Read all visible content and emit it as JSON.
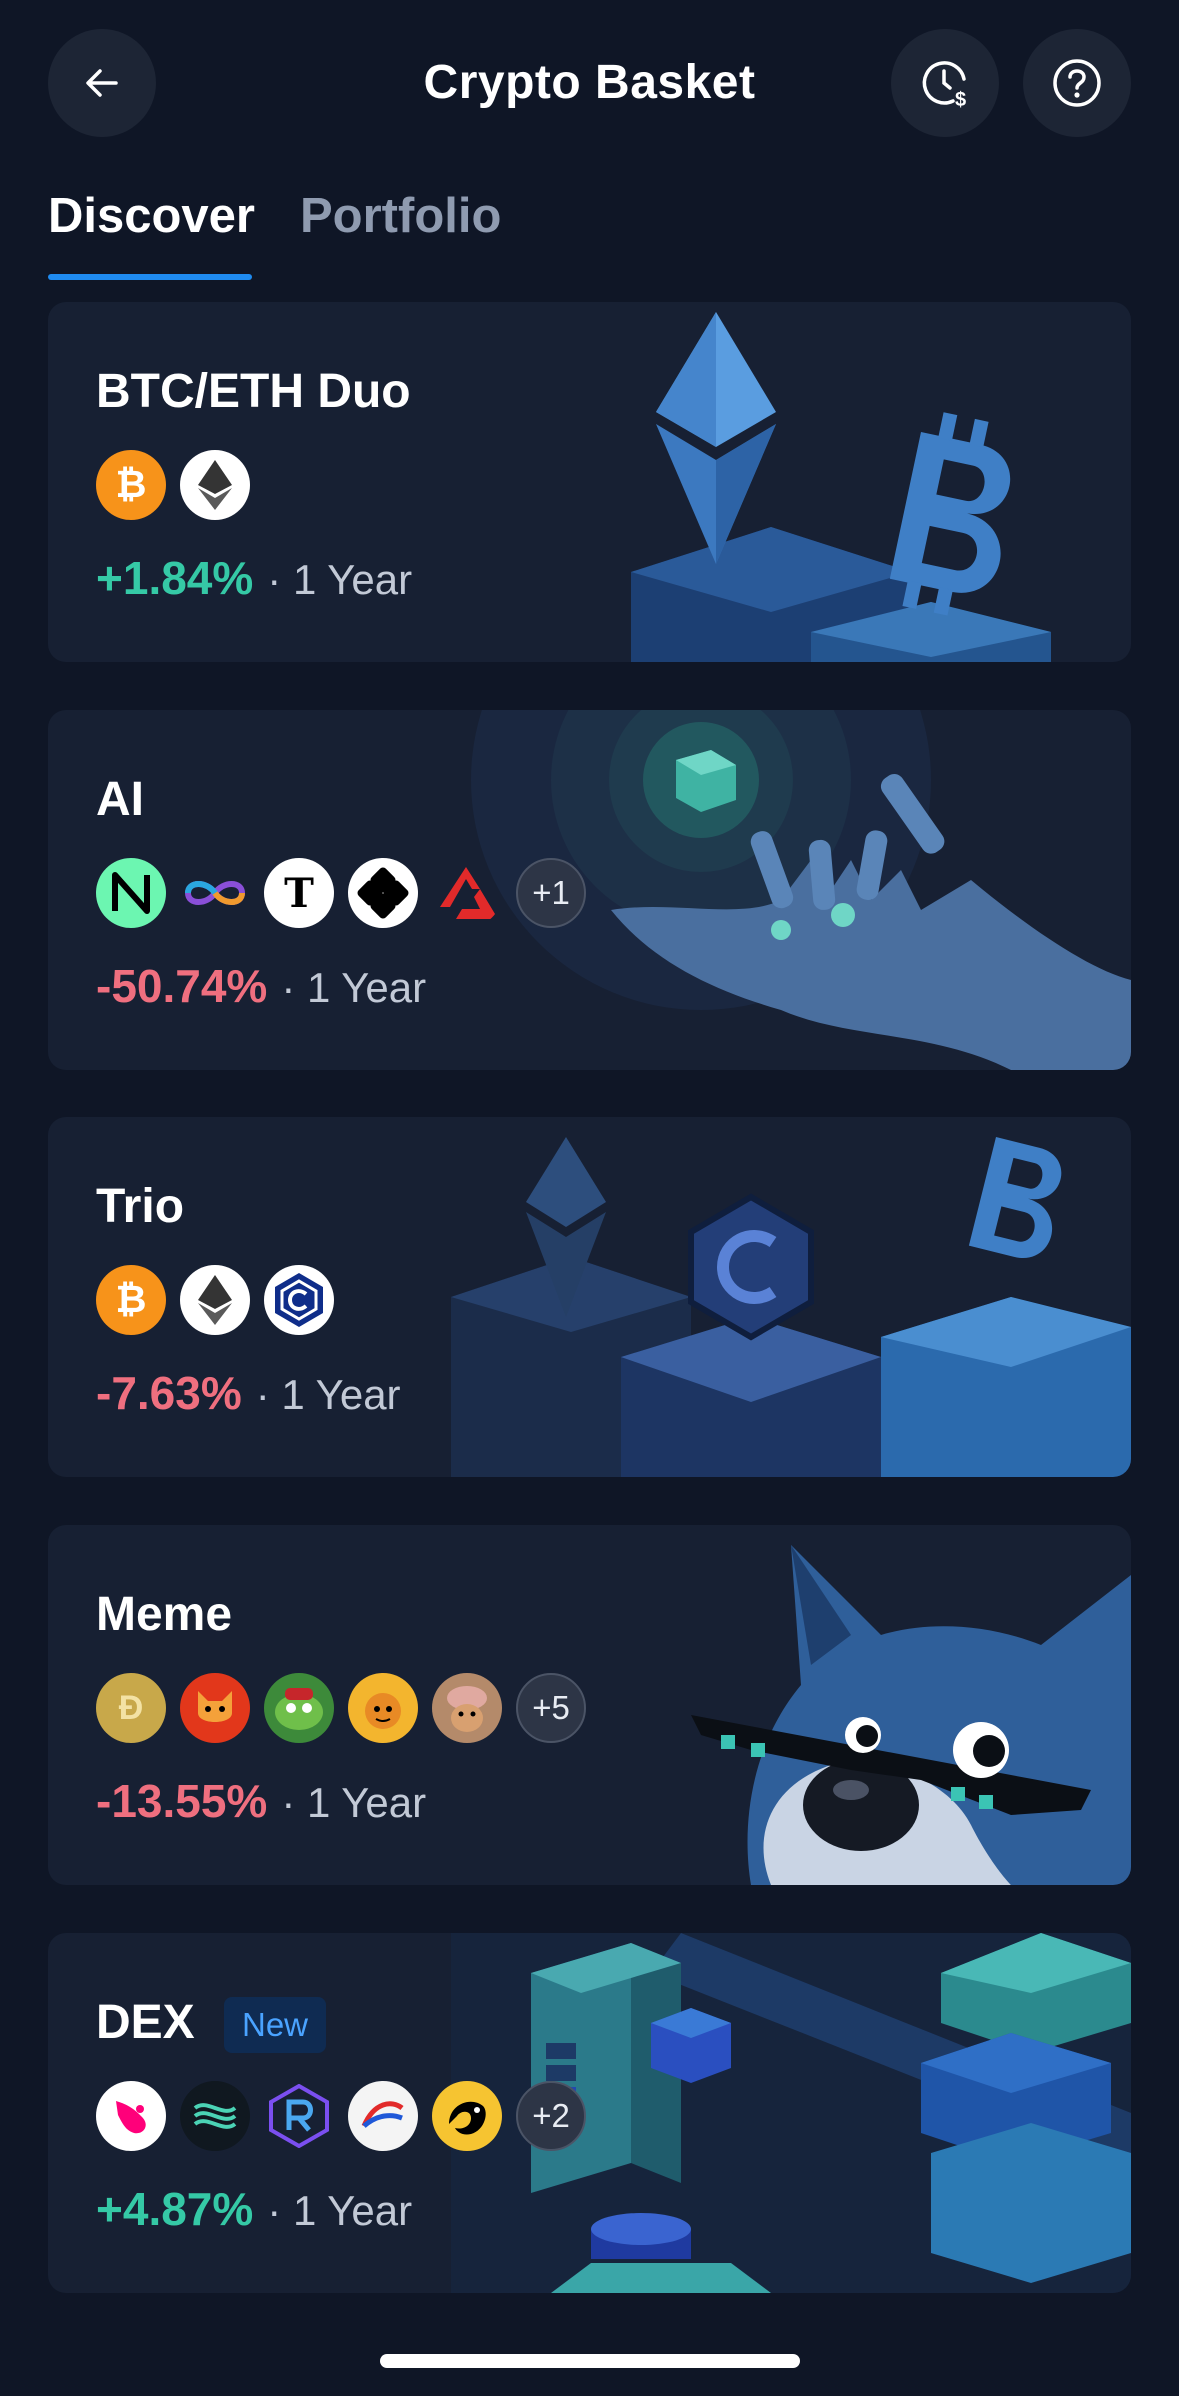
{
  "header": {
    "title": "Crypto Basket",
    "back_icon": "arrow-left-icon",
    "history_icon": "clock-dollar-icon",
    "help_icon": "question-circle-icon"
  },
  "tabs": [
    {
      "label": "Discover",
      "active": true
    },
    {
      "label": "Portfolio",
      "active": false
    }
  ],
  "colors": {
    "background": "#0f1626",
    "card": "#172033",
    "accent": "#1f8bf0",
    "positive": "#35c9a6",
    "negative": "#ef6f7f"
  },
  "baskets": [
    {
      "name": "BTC/ETH Duo",
      "badge": "",
      "coins": [
        "bitcoin-icon",
        "ethereum-icon"
      ],
      "extra_count": "",
      "change": "+1.84%",
      "period": "· 1 Year",
      "art": "ethereum-bitcoin-pedestal-art"
    },
    {
      "name": "AI",
      "badge": "",
      "coins": [
        "near-icon",
        "internet-computer-icon",
        "bittensor-icon",
        "render-icon",
        "arweave-icon"
      ],
      "extra_count": "+1",
      "change": "-50.74%",
      "period": "· 1 Year",
      "art": "robot-hand-cube-art"
    },
    {
      "name": "Trio",
      "badge": "",
      "coins": [
        "bitcoin-icon",
        "ethereum-icon",
        "cronos-icon"
      ],
      "extra_count": "",
      "change": "-7.63%",
      "period": "· 1 Year",
      "art": "three-pedestals-art"
    },
    {
      "name": "Meme",
      "badge": "",
      "coins": [
        "dogecoin-icon",
        "shiba-inu-icon",
        "pepe-icon",
        "bonk-icon",
        "dogwifhat-icon"
      ],
      "extra_count": "+5",
      "change": "-13.55%",
      "period": "· 1 Year",
      "art": "shiba-sunglasses-art"
    },
    {
      "name": "DEX",
      "badge": "New",
      "coins": [
        "uniswap-icon",
        "sei-icon",
        "raydium-icon",
        "curve-icon",
        "orca-icon"
      ],
      "extra_count": "+2",
      "change": "+4.87%",
      "period": "· 1 Year",
      "art": "isometric-blocks-art"
    }
  ]
}
